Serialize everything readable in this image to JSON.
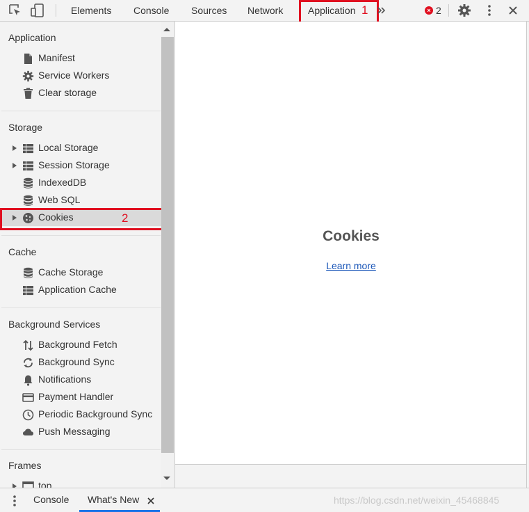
{
  "toolbar": {
    "tabs": [
      {
        "label": "Elements"
      },
      {
        "label": "Console"
      },
      {
        "label": "Sources"
      },
      {
        "label": "Network"
      },
      {
        "label": "Application"
      }
    ],
    "error_count": "2",
    "annotation_1": "1"
  },
  "sidebar": {
    "application": {
      "title": "Application",
      "items": [
        {
          "label": "Manifest",
          "icon": "file-icon"
        },
        {
          "label": "Service Workers",
          "icon": "gear-icon"
        },
        {
          "label": "Clear storage",
          "icon": "trash-icon"
        }
      ]
    },
    "storage": {
      "title": "Storage",
      "items": [
        {
          "label": "Local Storage",
          "icon": "grid-icon"
        },
        {
          "label": "Session Storage",
          "icon": "grid-icon"
        },
        {
          "label": "IndexedDB",
          "icon": "database-icon"
        },
        {
          "label": "Web SQL",
          "icon": "database-icon"
        },
        {
          "label": "Cookies",
          "icon": "cookie-icon"
        }
      ],
      "annotation_2": "2"
    },
    "cache": {
      "title": "Cache",
      "items": [
        {
          "label": "Cache Storage",
          "icon": "database-icon"
        },
        {
          "label": "Application Cache",
          "icon": "grid-icon"
        }
      ]
    },
    "background_services": {
      "title": "Background Services",
      "items": [
        {
          "label": "Background Fetch",
          "icon": "arrows-updown-icon"
        },
        {
          "label": "Background Sync",
          "icon": "sync-icon"
        },
        {
          "label": "Notifications",
          "icon": "bell-icon"
        },
        {
          "label": "Payment Handler",
          "icon": "card-icon"
        },
        {
          "label": "Periodic Background Sync",
          "icon": "clock-icon"
        },
        {
          "label": "Push Messaging",
          "icon": "cloud-icon"
        }
      ]
    },
    "frames": {
      "title": "Frames",
      "items": [
        {
          "label": "top",
          "icon": "frame-icon"
        }
      ]
    }
  },
  "main": {
    "title": "Cookies",
    "link": "Learn more"
  },
  "drawer": {
    "tabs": [
      {
        "label": "Console"
      },
      {
        "label": "What's New"
      }
    ],
    "watermark": "https://blog.csdn.net/weixin_45468845"
  },
  "colors": {
    "annotation_red": "#e01020",
    "link_blue": "#1a56b8",
    "panel_bg": "#f3f3f3"
  }
}
